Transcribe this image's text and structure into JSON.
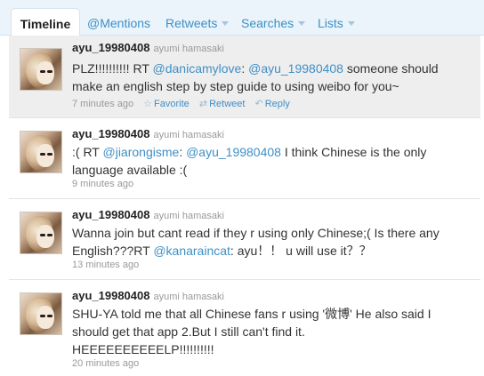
{
  "tabs": [
    {
      "label": "Timeline",
      "active": true
    },
    {
      "label": "@Mentions",
      "active": false
    },
    {
      "label": "Retweets",
      "active": false,
      "dropdown": true
    },
    {
      "label": "Searches",
      "active": false,
      "dropdown": true
    },
    {
      "label": "Lists",
      "active": false,
      "dropdown": true
    }
  ],
  "tweets": [
    {
      "screen_name": "ayu_19980408",
      "full_name": "ayumi hamasaki",
      "line1_a": "PLZ!!!!!!!!!! RT ",
      "line1_m1": "@danicamylove",
      "line1_b": ": ",
      "line1_m2": "@ayu_19980408",
      "line1_c": " someone should",
      "line2": "make an english step by step guide to using weibo for you~",
      "time": "7 minutes ago",
      "actions": {
        "favorite": "Favorite",
        "retweet": "Retweet",
        "reply": "Reply"
      }
    },
    {
      "screen_name": "ayu_19980408",
      "full_name": "ayumi hamasaki",
      "line1_a": ":( RT ",
      "line1_m1": "@jiarongisme",
      "line1_b": ": ",
      "line1_m2": "@ayu_19980408",
      "line1_c": " I think Chinese is the only",
      "line2": "language available :(",
      "time": "9 minutes ago"
    },
    {
      "screen_name": "ayu_19980408",
      "full_name": "ayumi hamasaki",
      "line1": "Wanna join but cant read if they r using only Chinese;( Is there any",
      "line2_a": "English???RT ",
      "line2_m": "@kanaraincat",
      "line2_b": ": ayu！！ u will use it？？",
      "time": "13 minutes ago"
    },
    {
      "screen_name": "ayu_19980408",
      "full_name": "ayumi hamasaki",
      "line1": "SHU-YA told me that all Chinese fans r using '微博' He also said I",
      "line2": "should get that app 2.But I still can't find it.",
      "line3": "HEEEEEEEEEELP!!!!!!!!!!",
      "time": "20 minutes ago"
    }
  ]
}
